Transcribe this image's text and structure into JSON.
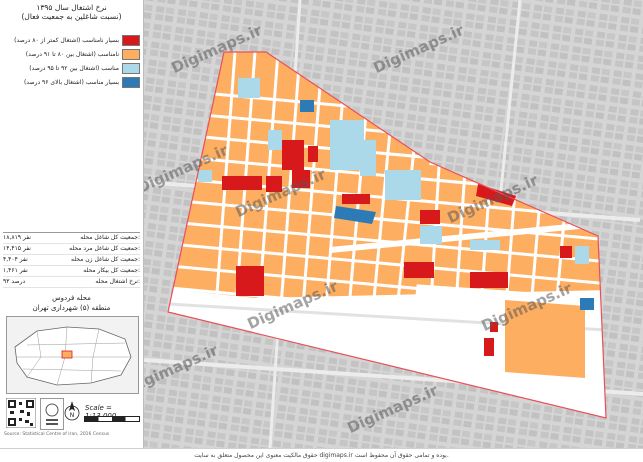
{
  "map": {
    "title_lines": [
      "نرخ اشتغال سال ۱۳۹۵",
      "(نسبت شاغلین به جمعیت فعال)"
    ],
    "legend": [
      {
        "label": "بسیار نامناسب (اشتغال کمتر از ۸۰ درصد)",
        "color": "#d7191c"
      },
      {
        "label": "نامناسب (اشتغال بین ۸۰ تا ۹۱ درصد)",
        "color": "#fdae61"
      },
      {
        "label": "مناسب (اشتغال بین ۹۲ تا ۹۵ درصد)",
        "color": "#abd9e9"
      },
      {
        "label": "بسیار مناسب (اشتغال بالای ۹۶ درصد)",
        "color": "#2c7bb6"
      }
    ],
    "stats": [
      {
        "label": "جمعیت کل شاغل محله:",
        "value": "۱۸,۸۱۹ نفر"
      },
      {
        "label": "جمعیت کل شاغل مرد محله:",
        "value": "۱۴,۴۱۵ نفر"
      },
      {
        "label": "جمعیت کل شاغل زن محله:",
        "value": "۴,۴۰۴ نفر"
      },
      {
        "label": "جمعیت کل بیکار محله:",
        "value": "۱,۴۶۱ نفر"
      },
      {
        "label": "نرخ اشتغال محله:",
        "value": "۹۳ درصد"
      }
    ],
    "district_name": "محله فردوس",
    "district_region": "منطقه (۵) شهرداری تهران",
    "scale": "Scale = 1:13,000",
    "watermark": "Digimaps.ir",
    "footer_text": "حقوق مالکیت معنوی این محصول متعلق به سایت digimaps.ir بوده و تمامی حقوق آن محفوظ است.",
    "credit_text": "Source: Statistical Centre of Iran, 2016 Census"
  }
}
